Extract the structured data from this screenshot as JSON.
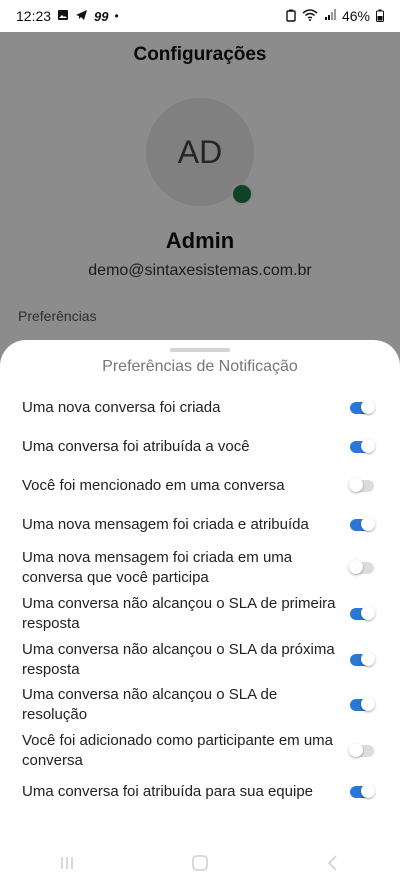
{
  "status_bar": {
    "time": "12:23",
    "notification_count": "99",
    "battery": "46%"
  },
  "page": {
    "title": "Configurações",
    "avatar_initials": "AD",
    "user_name": "Admin",
    "user_email": "demo@sintaxesistemas.com.br",
    "section_label": "Preferências"
  },
  "sheet": {
    "title": "Preferências de Notificação",
    "preferences": [
      {
        "label": "Uma nova conversa foi criada",
        "enabled": true
      },
      {
        "label": "Uma conversa foi atribuída a você",
        "enabled": true
      },
      {
        "label": "Você foi mencionado em uma conversa",
        "enabled": false
      },
      {
        "label": "Uma nova mensagem foi criada e atribuída",
        "enabled": true
      },
      {
        "label": "Uma nova mensagem foi criada em uma conversa que você participa",
        "enabled": false
      },
      {
        "label": "Uma conversa não alcançou o SLA de primeira resposta",
        "enabled": true
      },
      {
        "label": "Uma conversa não alcançou o SLA da próxima resposta",
        "enabled": true
      },
      {
        "label": "Uma conversa não alcançou o SLA de resolução",
        "enabled": true
      },
      {
        "label": "Você foi adicionado como participante em uma conversa",
        "enabled": false
      },
      {
        "label": "Uma conversa foi atribuída para sua equipe",
        "enabled": true
      }
    ]
  },
  "colors": {
    "accent": "#2a78d6",
    "online": "#1d7a4a"
  }
}
